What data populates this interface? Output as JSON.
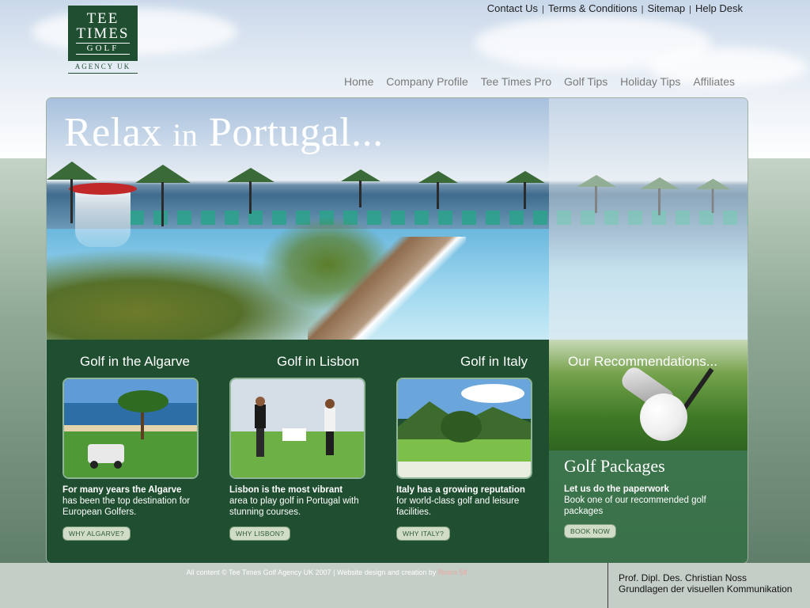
{
  "logo": {
    "line1": "TEE",
    "line2": "TIMES",
    "line3": "GOLF",
    "sub": "AGENCY UK"
  },
  "top_links": [
    {
      "label": "Contact Us"
    },
    {
      "label": "Terms & Conditions"
    },
    {
      "label": "Sitemap"
    },
    {
      "label": "Help Desk"
    }
  ],
  "nav": [
    {
      "label": "Home"
    },
    {
      "label": "Company Profile"
    },
    {
      "label": "Tee Times Pro"
    },
    {
      "label": "Golf Tips"
    },
    {
      "label": "Holiday Tips"
    },
    {
      "label": "Affiliates"
    }
  ],
  "hero": {
    "title": "Relax",
    "title_small": "in",
    "title_end": "Portugal..."
  },
  "columns": [
    {
      "heading": "Golf in the Algarve",
      "bold": "For many years the Algarve",
      "text": "has been the top destination for European Golfers.",
      "button": "WHY ALGARVE?"
    },
    {
      "heading": "Golf in Lisbon",
      "bold": "Lisbon is the most vibrant",
      "text": "area to play golf in Portugal with stunning courses.",
      "button": "WHY LISBON?"
    },
    {
      "heading": "Golf in Italy",
      "bold": "Italy has a growing reputation",
      "text": "for world-class golf and leisure facilities.",
      "button": "WHY ITALY?"
    }
  ],
  "recommendations": {
    "heading": "Our Recommendations...",
    "title": "Golf Packages",
    "bold": "Let us do the paperwork",
    "text": "Book one of our recommended golf packages",
    "button": "BOOK NOW"
  },
  "footer": {
    "text": "All content © Tee Times Golf Agency UK 2007 | Website design and creation by",
    "credit": "Room 58",
    "prof_line1": "Prof. Dipl. Des. Christian Noss",
    "prof_line2": "Grundlagen der visuellen Kommunikation"
  },
  "colors": {
    "brand_green": "#1f4f30",
    "accent_green": "#3e7a4d",
    "button_bg": "#d0dcc8"
  }
}
